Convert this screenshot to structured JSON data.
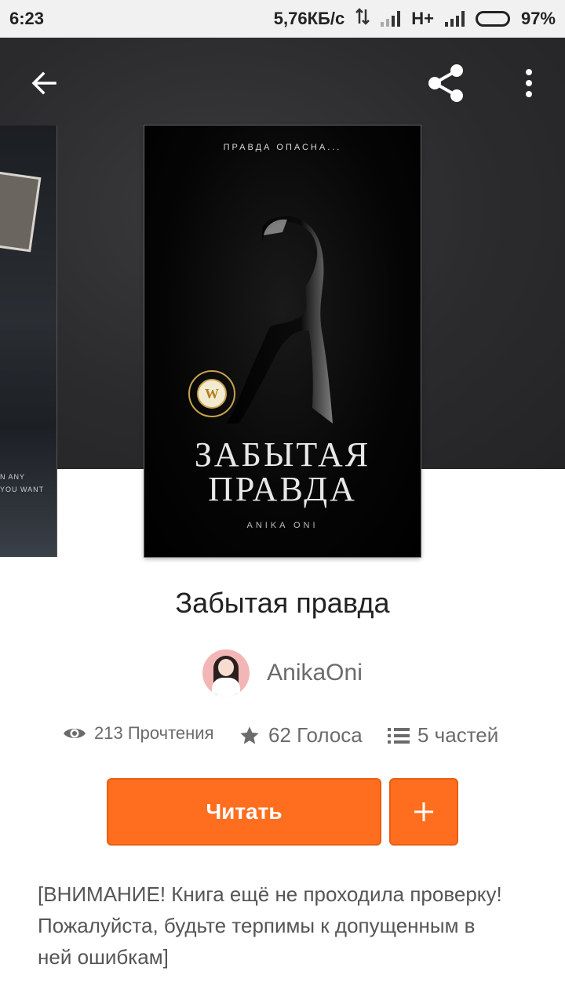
{
  "status_bar": {
    "time": "6:23",
    "speed": "5,76КБ/с",
    "network": "H+",
    "battery": "97%"
  },
  "toolbar": {
    "back_icon": "arrow-left-icon",
    "share_icon": "share-icon",
    "more_icon": "more-vertical-icon"
  },
  "cover": {
    "tagline": "ПРАВДА ОПАСНА...",
    "title": "ЗАБЫТАЯ ПРАВДА",
    "author": "ANIKA ONI"
  },
  "side_cover": {
    "text": "N ANY\nYOU WANT"
  },
  "book": {
    "title": "Забытая правда",
    "author": "AnikaOni"
  },
  "stats": {
    "reads": "213 Прочтения",
    "votes": "62 Голоса",
    "parts": "5 частей"
  },
  "actions": {
    "read_label": "Читать",
    "add_icon": "plus-icon"
  },
  "description": "[ВНИМАНИЕ! Книга ещё не проходила проверку! Пожалуйста, будьте терпимы к допущенным в ней ошибкам]",
  "colors": {
    "accent": "#ff6e1f",
    "header_bg": "#2b2b2d"
  }
}
